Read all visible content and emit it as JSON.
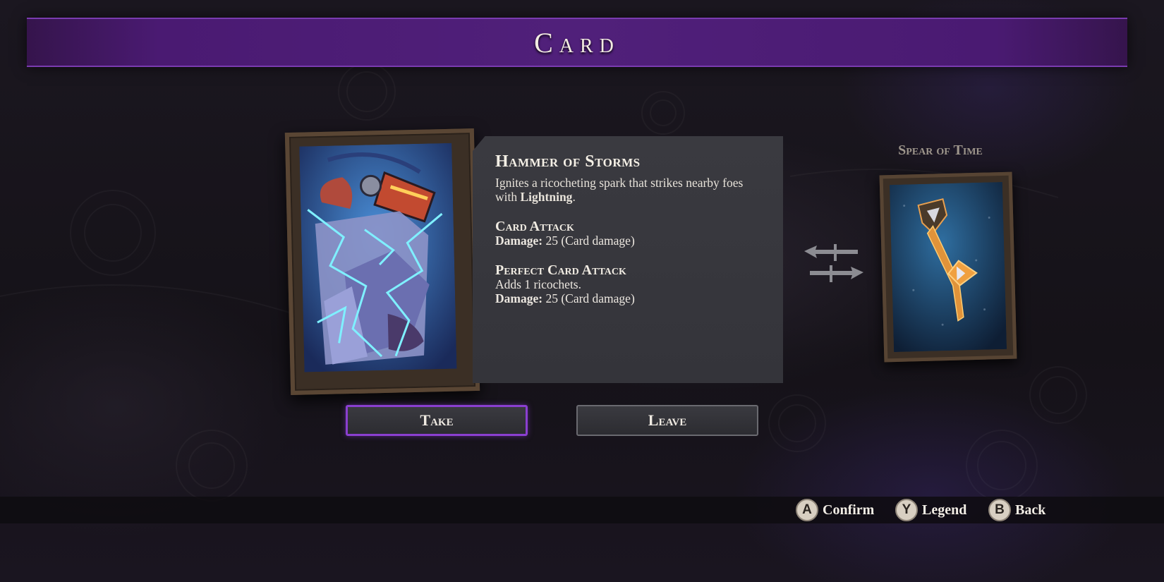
{
  "header": {
    "title": "Card"
  },
  "card": {
    "name": "Hammer of Storms",
    "description_prefix": "Ignites a ricocheting spark that strikes nearby foes with ",
    "description_keyword": "Lightning",
    "description_suffix": ".",
    "sections": [
      {
        "title": "Card Attack",
        "lines": [
          {
            "label": "Damage:",
            "value": " 25 (Card damage)"
          }
        ]
      },
      {
        "title": "Perfect Card Attack",
        "note": "Adds 1 ricochets.",
        "lines": [
          {
            "label": "Damage:",
            "value": " 25 (Card damage)"
          }
        ]
      }
    ]
  },
  "current_card": {
    "name": "Spear of Time"
  },
  "actions": {
    "take": "Take",
    "leave": "Leave"
  },
  "hints": [
    {
      "key": "A",
      "label": "Confirm"
    },
    {
      "key": "Y",
      "label": "Legend"
    },
    {
      "key": "B",
      "label": "Back"
    }
  ],
  "colors": {
    "accent": "#8a3fd0",
    "banner": "#4a1a72",
    "panel": "#36363c"
  },
  "icons": {
    "swap": "swap-arrows-icon"
  }
}
